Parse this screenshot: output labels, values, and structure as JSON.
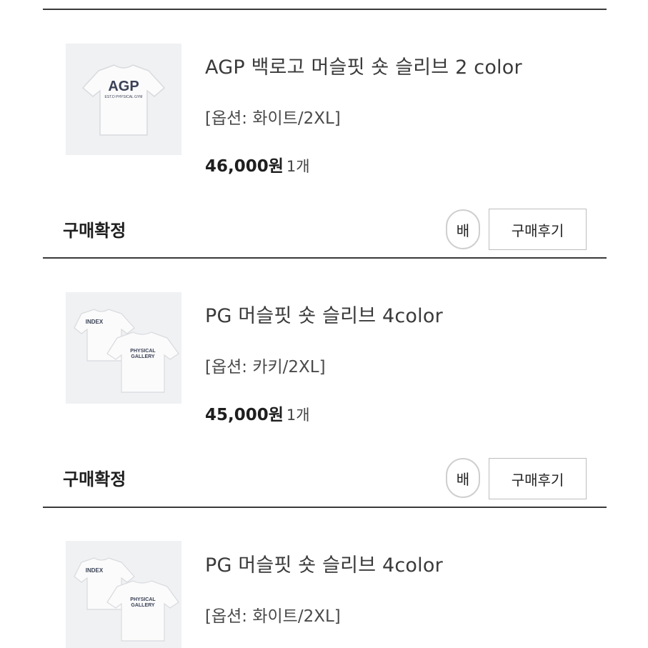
{
  "orders": [
    {
      "title": "AGP 백로고 머슬핏 숏 슬리브 2 color",
      "option": "[옵션: 화이트/2XL]",
      "price": "46,000원",
      "qty": "1개",
      "status": "구매확정",
      "delivery_button": "배",
      "review_button": "구매후기",
      "image_text": {
        "logo": "AGP",
        "sub": "EST.D PHYSICAL GYM"
      }
    },
    {
      "title": "PG 머슬핏 숏 슬리브 4color",
      "option": "[옵션: 카키/2XL]",
      "price": "45,000원",
      "qty": "1개",
      "status": "구매확정",
      "delivery_button": "배",
      "review_button": "구매후기",
      "image_text": {
        "front": "INDEX",
        "back1": "PHYSICAL",
        "back2": "GALLERY"
      }
    },
    {
      "title": "PG 머슬핏 숏 슬리브 4color",
      "option": "[옵션: 화이트/2XL]",
      "image_text": {
        "front": "INDEX",
        "back1": "PHYSICAL",
        "back2": "GALLERY"
      }
    }
  ]
}
